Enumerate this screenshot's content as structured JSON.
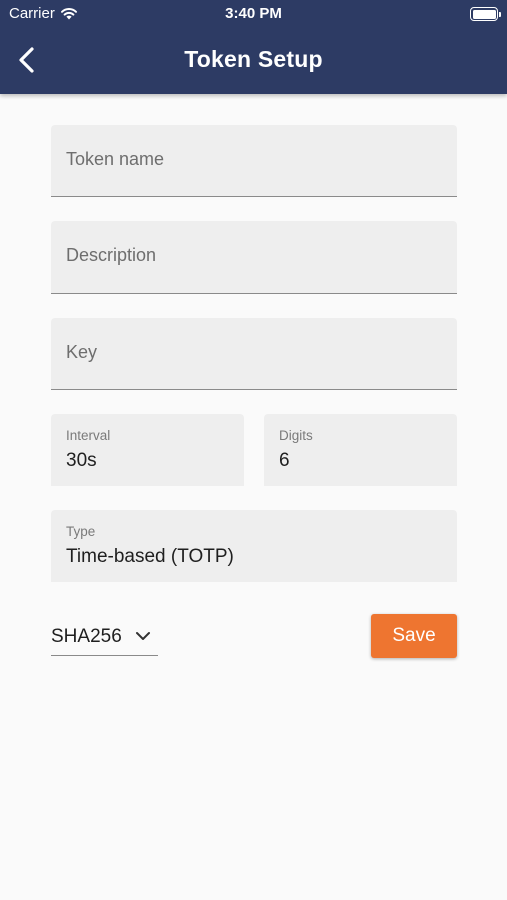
{
  "status_bar": {
    "carrier": "Carrier",
    "time": "3:40 PM"
  },
  "header": {
    "title": "Token Setup"
  },
  "form": {
    "token_name": {
      "placeholder": "Token name",
      "value": ""
    },
    "description": {
      "placeholder": "Description",
      "value": ""
    },
    "key": {
      "placeholder": "Key",
      "value": ""
    },
    "interval": {
      "label": "Interval",
      "value": "30s"
    },
    "digits": {
      "label": "Digits",
      "value": "6"
    },
    "type": {
      "label": "Type",
      "value": "Time-based (TOTP)"
    },
    "algorithm": {
      "selected": "SHA256"
    },
    "save_label": "Save"
  },
  "colors": {
    "header_bg": "#2d3b64",
    "accent": "#ee7530",
    "field_bg": "#eeeeee",
    "page_bg": "#fafafa"
  }
}
